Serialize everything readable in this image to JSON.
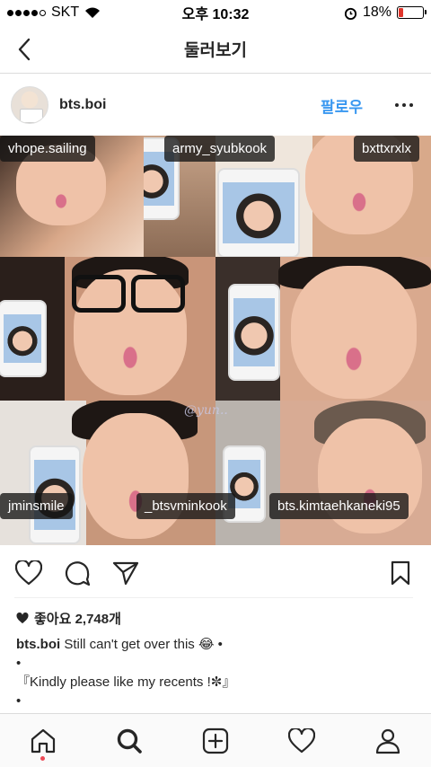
{
  "status_bar": {
    "carrier": "SKT",
    "time": "오후 10:32",
    "battery": "18%",
    "battery_level": 0.18,
    "battery_color": "#e0352b"
  },
  "nav": {
    "title": "둘러보기"
  },
  "post": {
    "username": "bts.boi",
    "follow_label": "팔로우",
    "follow_color": "#3897f0",
    "photo_tags": [
      "vhope.sailing",
      "army_syubkook",
      "bxttxrxlx",
      "jminsmile",
      "_btsvminkook",
      "bts.kimtaehkaneki95"
    ],
    "watermark": "@yun..",
    "likes_label": "좋아요 2,748개",
    "caption_lines": [
      {
        "user": "bts.boi",
        "text": "Still can't get over this 😂 •"
      },
      {
        "text": "•"
      },
      {
        "text": "『Kindly please like my recents !✼』"
      },
      {
        "text": "•"
      }
    ]
  },
  "icons": {
    "actions": [
      "heart-icon",
      "comment-icon",
      "share-icon",
      "bookmark-icon"
    ],
    "tabs": [
      "home-icon",
      "search-icon",
      "add-icon",
      "activity-icon",
      "profile-icon"
    ]
  }
}
